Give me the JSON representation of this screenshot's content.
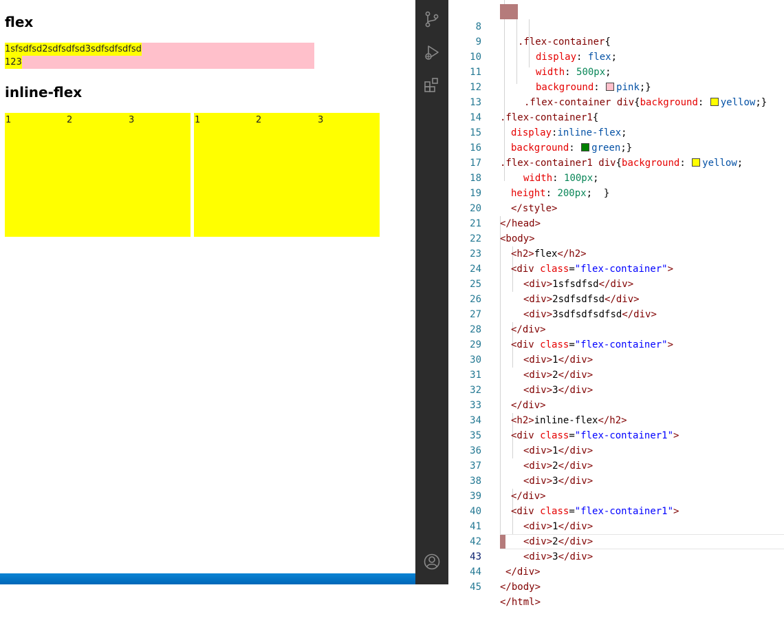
{
  "preview": {
    "heading_flex": "flex",
    "flex_row1": "1sfsdfsd2sdfsdfsd3sdfsdfsdfsd",
    "flex_row2": "123",
    "heading_inline": "inline-flex",
    "inline_boxes": [
      {
        "c1": "1",
        "c2": "2",
        "c3": "3"
      },
      {
        "c1": "1",
        "c2": "2",
        "c3": "3"
      }
    ]
  },
  "activity_bar": {
    "icons": [
      "source-control-icon",
      "run-debug-icon",
      "extensions-icon",
      "account-icon"
    ]
  },
  "editor": {
    "current_line": 43,
    "swatches": {
      "pink": "#ffc0cb",
      "yellow": "#ffff00",
      "green": "#008000"
    },
    "lines": [
      {
        "n": "8",
        "t": ".flex-container{"
      },
      {
        "n": "9",
        "t": "display: flex;"
      },
      {
        "n": "10",
        "t": "width: 500px;"
      },
      {
        "n": "11",
        "t": "background: pink;}"
      },
      {
        "n": "12",
        "t": ".flex-container div{background: yellow;}"
      },
      {
        "n": "13",
        "t": ".flex-container1{"
      },
      {
        "n": "14",
        "t": "display:inline-flex;"
      },
      {
        "n": "15",
        "t": "background: green;}"
      },
      {
        "n": "16",
        "t": ".flex-container1 div{background: yellow;"
      },
      {
        "n": "17",
        "t": "width: 100px;"
      },
      {
        "n": "18",
        "t": "height: 200px;  }"
      },
      {
        "n": "19",
        "t": "</style>"
      },
      {
        "n": "20",
        "t": "</head>"
      },
      {
        "n": "21",
        "t": "<body>"
      },
      {
        "n": "22",
        "t": "<h2>flex</h2>"
      },
      {
        "n": "23",
        "t": "<div class=\"flex-container\">"
      },
      {
        "n": "24",
        "t": "<div>1sfsdfsd</div>"
      },
      {
        "n": "25",
        "t": "<div>2sdfsdfsd</div>"
      },
      {
        "n": "26",
        "t": "<div>3sdfsdfsdfsd</div>"
      },
      {
        "n": "27",
        "t": "</div>"
      },
      {
        "n": "28",
        "t": "<div class=\"flex-container\">"
      },
      {
        "n": "29",
        "t": "<div>1</div>"
      },
      {
        "n": "30",
        "t": "<div>2</div>"
      },
      {
        "n": "31",
        "t": "<div>3</div>"
      },
      {
        "n": "32",
        "t": "</div>"
      },
      {
        "n": "33",
        "t": "<h2>inline-flex</h2>"
      },
      {
        "n": "34",
        "t": "<div class=\"flex-container1\">"
      },
      {
        "n": "35",
        "t": "<div>1</div>"
      },
      {
        "n": "36",
        "t": "<div>2</div>"
      },
      {
        "n": "37",
        "t": "<div>3</div>"
      },
      {
        "n": "38",
        "t": "</div>"
      },
      {
        "n": "39",
        "t": "<div class=\"flex-container1\">"
      },
      {
        "n": "40",
        "t": "<div>1</div>"
      },
      {
        "n": "41",
        "t": "<div>2</div>"
      },
      {
        "n": "42",
        "t": "<div>3</div>"
      },
      {
        "n": "43",
        "t": "</div>"
      },
      {
        "n": "44",
        "t": "</body>"
      },
      {
        "n": "45",
        "t": "</html>"
      }
    ]
  }
}
